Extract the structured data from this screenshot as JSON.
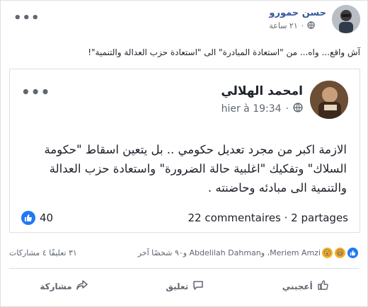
{
  "outer_post": {
    "author": "حسن حمورو",
    "time": "٢١ ساعة",
    "text": "آش واقع... واه... من \"استعادة المبادرة\" الى \"استعادة حزب العدالة والتنمية\"!"
  },
  "shared_post": {
    "author": "امحمد الهلالي",
    "time": "hier à 19:34",
    "text": "الازمة اكبر من مجرد تعديل حكومي  .. بل يتعين اسقاط \"حكومة السلاك\" وتفكيك \"اغلبية حالة الضرورة\" واستعادة حزب العدالة والتنمية الى مبادئه وحاضنته .",
    "likes": "40",
    "comments_shares": "22 commentaires · 2 partages"
  },
  "outer_stats": {
    "reactors": "Meriem Amzi، وAbdelilah Dahman و٩٠ شخصًا آخر",
    "comments_shares": "٣١ تعليقًا ٤ مشاركات"
  },
  "actions": {
    "share": "مشاركة",
    "comment": "تعليق",
    "like": "أعجبني"
  },
  "colors": {
    "link": "#385898",
    "like_blue": "#2078f4",
    "text_grey": "#606770"
  }
}
